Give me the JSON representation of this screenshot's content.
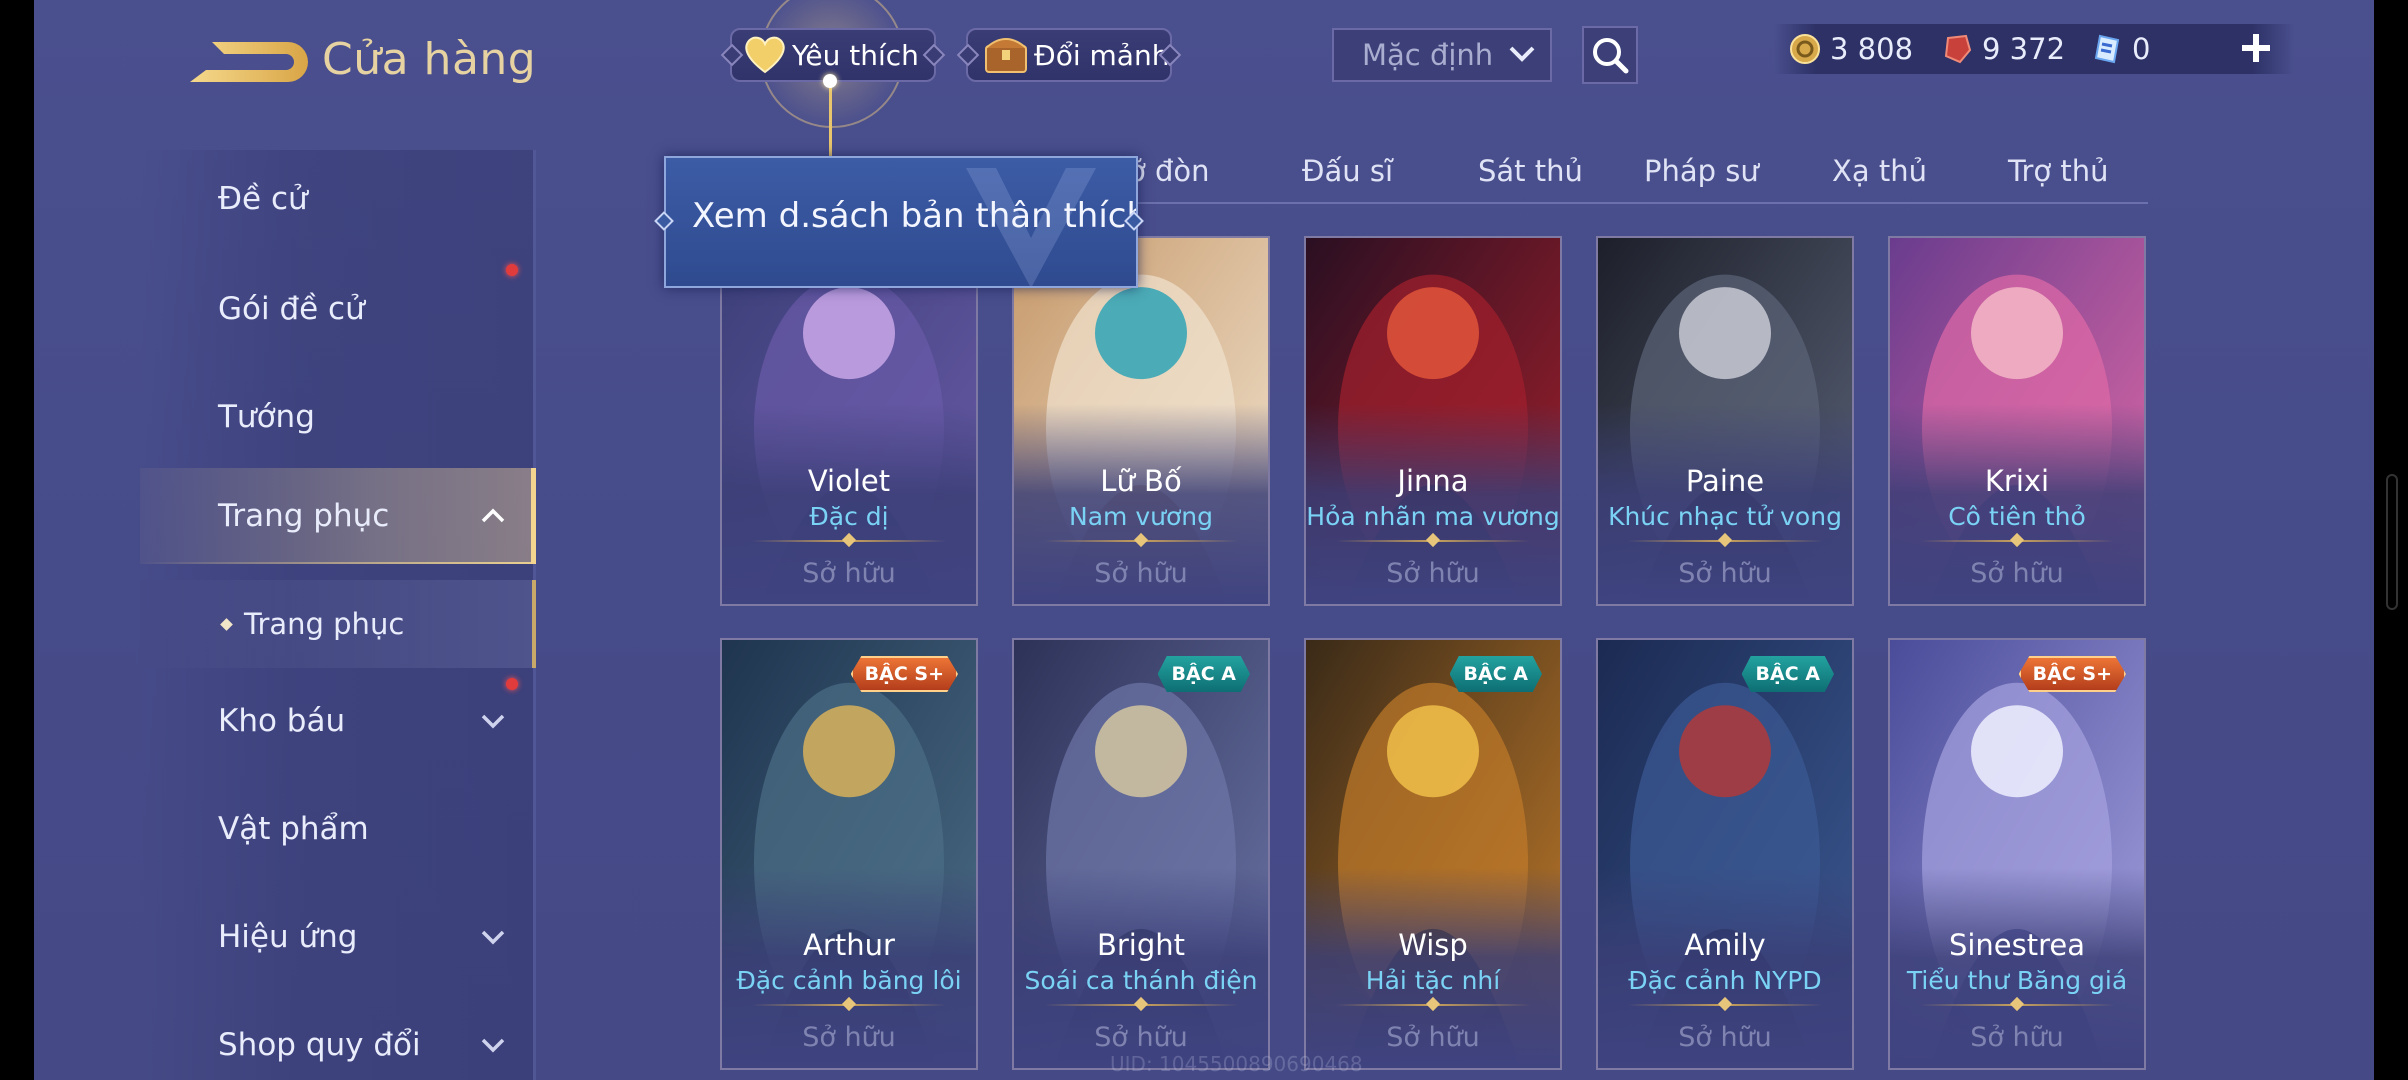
{
  "header": {
    "title": "Cửa hàng",
    "favorite_label": "Yêu thích",
    "exchange_label": "Đổi mảnh",
    "sort_value": "Mặc định"
  },
  "wallet": {
    "gold": "3 808",
    "gems": "9 372",
    "vouchers": "0"
  },
  "sidebar": {
    "items": [
      {
        "label": "Đề cử"
      },
      {
        "label": "Gói đề cử"
      },
      {
        "label": "Tướng"
      },
      {
        "label": "Trang phục"
      },
      {
        "label": "Trang phục"
      },
      {
        "label": "Kho báu"
      },
      {
        "label": "Vật phẩm"
      },
      {
        "label": "Hiệu ứng"
      },
      {
        "label": "Shop quy đổi"
      }
    ]
  },
  "tabs": [
    "ỡ đòn",
    "Đấu sĩ",
    "Sát thủ",
    "Pháp sư",
    "Xạ thủ",
    "Trợ thủ"
  ],
  "tooltip": "Xem d.sách bản thân thích",
  "cards": [
    {
      "hero": "Violet",
      "skin": "Đặc dị",
      "status": "Sở hữu",
      "badge": "",
      "palette": [
        "#3b3f78",
        "#6a5aa8",
        "#c9a7e8"
      ]
    },
    {
      "hero": "Lữ Bố",
      "skin": "Nam vương",
      "status": "Sở hữu",
      "badge": "",
      "palette": [
        "#c79a6c",
        "#f1e3cf",
        "#2fa3b5"
      ]
    },
    {
      "hero": "Jinna",
      "skin": "Hỏa nhãn ma vương",
      "status": "Sở hữu",
      "badge": "",
      "palette": [
        "#2a0f22",
        "#a3202c",
        "#e0553b"
      ]
    },
    {
      "hero": "Paine",
      "skin": "Khúc nhạc tử vong",
      "status": "Sở hữu",
      "badge": "",
      "palette": [
        "#1d1f2a",
        "#5b6478",
        "#c8c9d3"
      ]
    },
    {
      "hero": "Krixi",
      "skin": "Cô tiên thỏ",
      "status": "Sở hữu",
      "badge": "",
      "palette": [
        "#6a3c8e",
        "#e06aa6",
        "#f3b7c6"
      ]
    },
    {
      "hero": "Arthur",
      "skin": "Đặc cảnh băng lôi",
      "status": "Sở hữu",
      "badge": "BẬC S+",
      "palette": [
        "#1f3550",
        "#4c6d86",
        "#d8b25a"
      ]
    },
    {
      "hero": "Bright",
      "skin": "Soái ca thánh điện",
      "status": "Sở hữu",
      "badge": "BẬC A",
      "palette": [
        "#2d3258",
        "#6d76a8",
        "#d3c6a0"
      ]
    },
    {
      "hero": "Wisp",
      "skin": "Hải tặc nhí",
      "status": "Sở hữu",
      "badge": "BẬC A",
      "palette": [
        "#3a2a18",
        "#c07a2a",
        "#f0c04a"
      ]
    },
    {
      "hero": "Amily",
      "skin": "Đặc cảnh NYPD",
      "status": "Sở hữu",
      "badge": "BẬC A",
      "palette": [
        "#1b2a52",
        "#3c5a94",
        "#b03a3a"
      ]
    },
    {
      "hero": "Sinestrea",
      "skin": "Tiểu thư Băng giá",
      "status": "Sở hữu",
      "badge": "BẬC S+",
      "palette": [
        "#4a4c9a",
        "#a6a2e0",
        "#eef0ff"
      ]
    }
  ],
  "uid_text": "UID: 1045500890690468",
  "colors": {
    "accent_gold": "#e7d3a2",
    "skin_name_blue": "#7ad3f5",
    "notification_red": "#e23b3b"
  }
}
